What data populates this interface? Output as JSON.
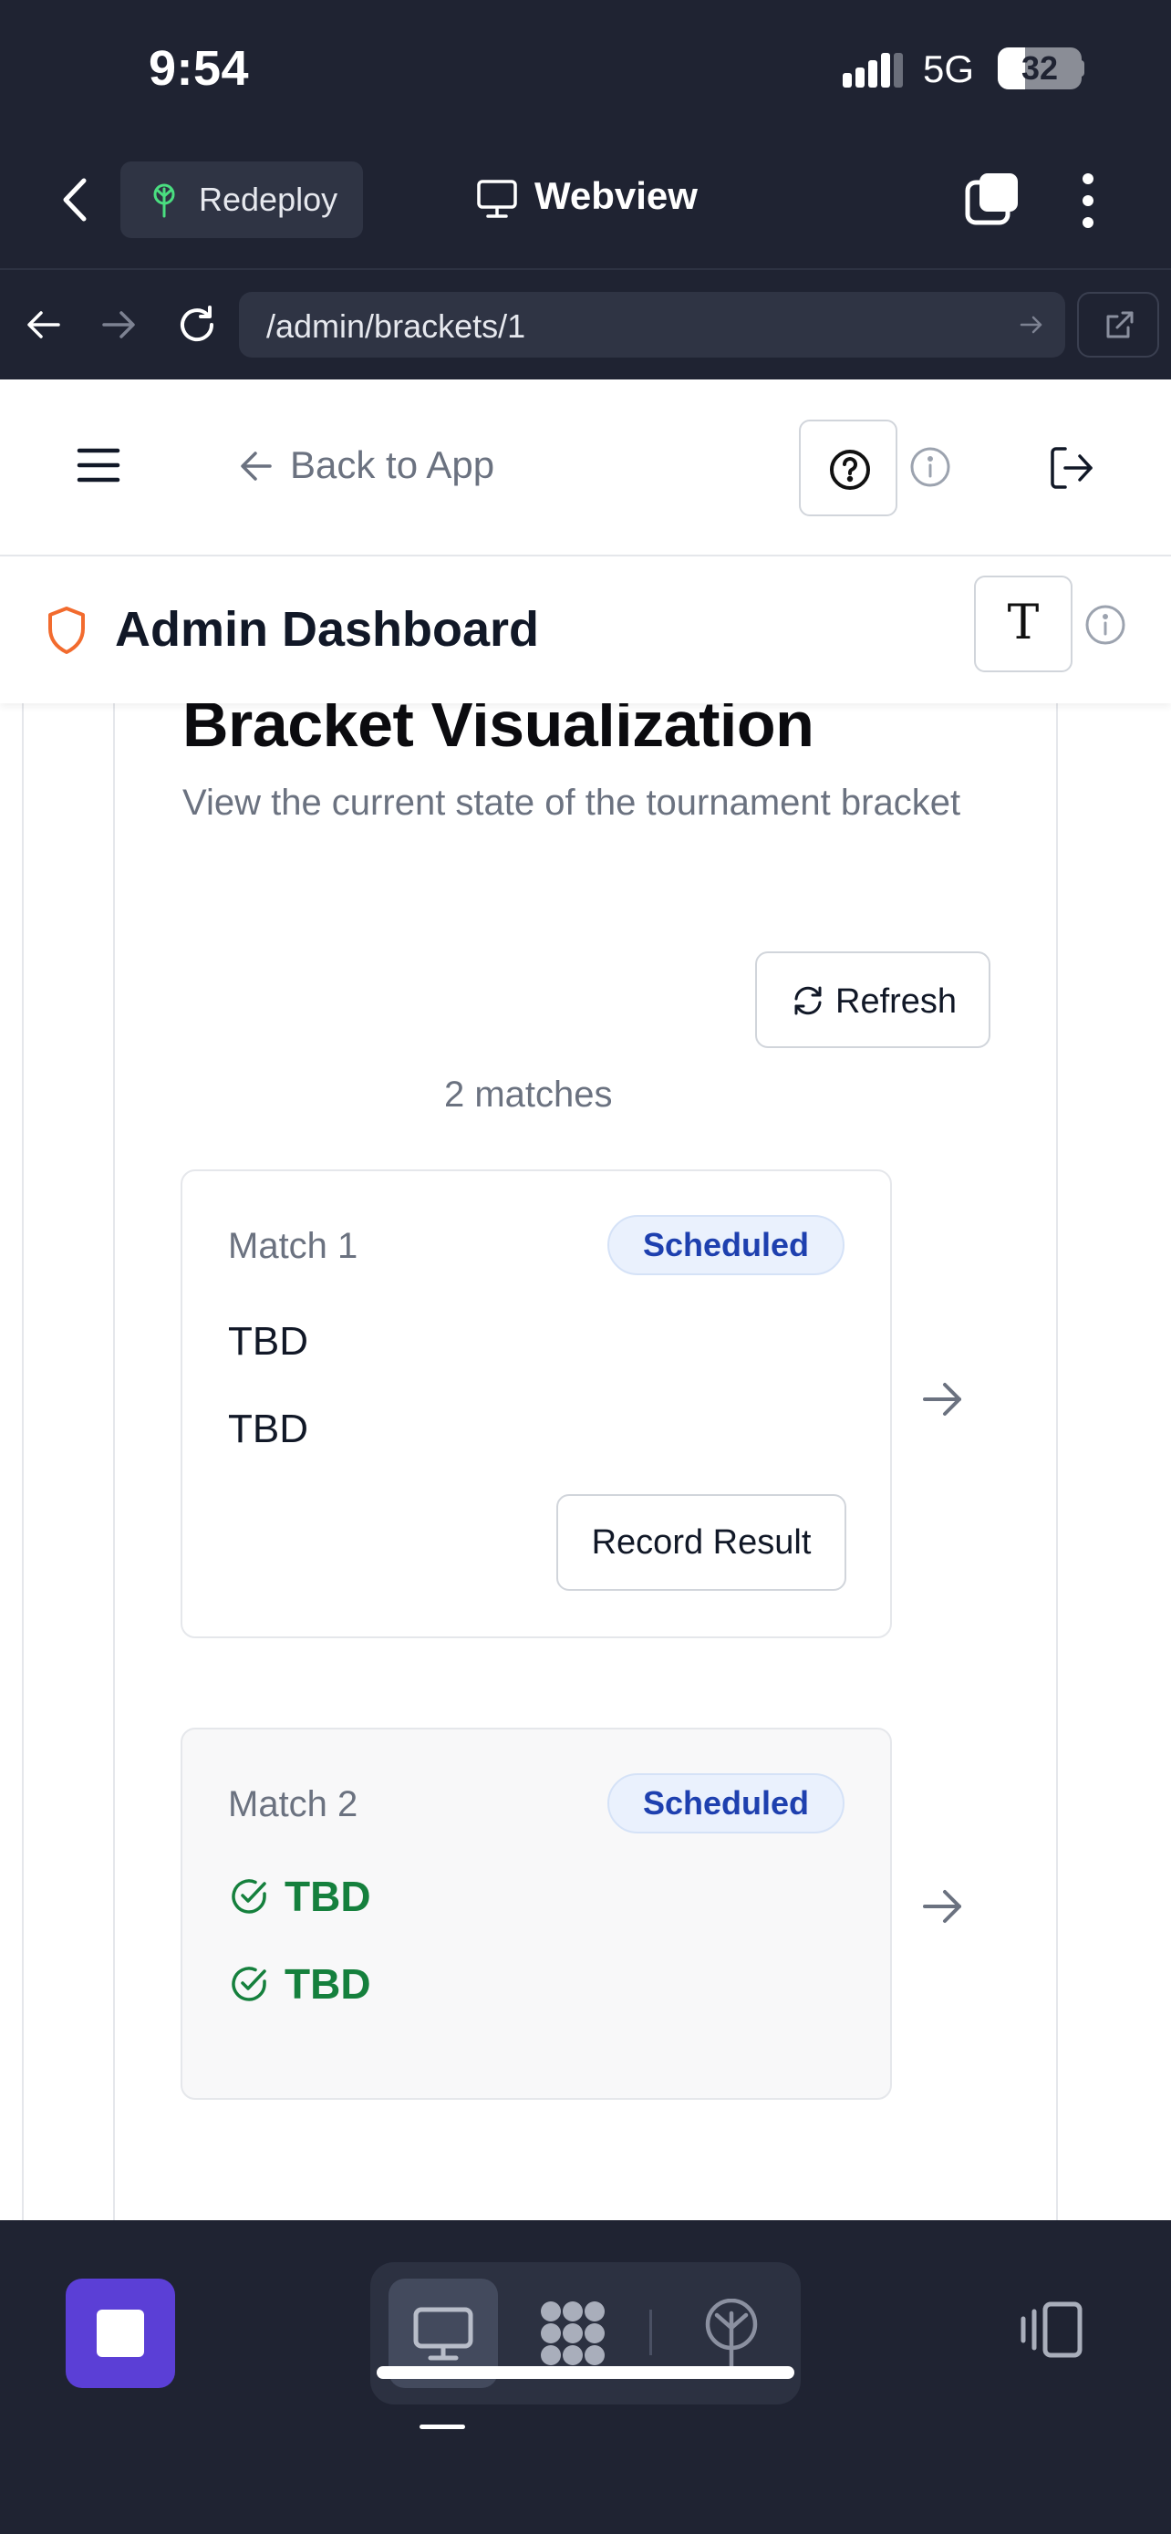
{
  "status_bar": {
    "time": "9:54",
    "network": "5G",
    "battery": "32"
  },
  "app_bar": {
    "redeploy_label": "Redeploy",
    "webview_label": "Webview"
  },
  "url_bar": {
    "url": "/admin/brackets/1"
  },
  "web_header": {
    "back_label": "Back to App"
  },
  "admin_bar": {
    "title": "Admin Dashboard",
    "font_button_label": "T"
  },
  "bracket": {
    "title": "Bracket Visualization",
    "subtitle": "View the current state of the tournament bracket",
    "refresh_label": "Refresh",
    "match_count": "2 matches",
    "matches": [
      {
        "name": "Match 1",
        "status": "Scheduled",
        "team1": "TBD",
        "team2": "TBD",
        "action_label": "Record Result"
      },
      {
        "name": "Match 2",
        "status": "Scheduled",
        "team1": "TBD",
        "team2": "TBD"
      }
    ]
  },
  "colors": {
    "accent_orange": "#f26b2e",
    "winner_green": "#15803d",
    "badge_blue": "#1e40af",
    "stop_purple": "#5b3fd6",
    "chrome_dark": "#1f2332"
  },
  "icons": {
    "status_bar": [
      "signal-icon"
    ],
    "app_bar": [
      "chevron-left-icon",
      "tree-icon",
      "monitor-icon",
      "tabs-icon",
      "more-vertical-icon"
    ],
    "url_bar": [
      "back-arrow-icon",
      "forward-arrow-icon",
      "reload-icon",
      "go-arrow-icon",
      "external-link-icon"
    ],
    "web_header": [
      "menu-icon",
      "arrow-left-icon",
      "help-circle-icon",
      "info-icon",
      "logout-icon"
    ],
    "admin_bar": [
      "shield-icon",
      "info-icon"
    ],
    "bracket": [
      "refresh-icon",
      "check-circle-icon",
      "arrow-right-icon"
    ],
    "toolbar": [
      "stop-icon",
      "monitor-icon",
      "grid-icon",
      "tree-icon",
      "device-rotate-icon"
    ]
  }
}
